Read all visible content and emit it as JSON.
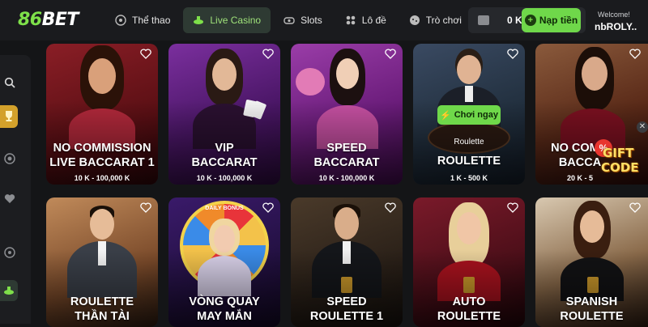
{
  "logo": {
    "prefix": "86",
    "suffix": "BET"
  },
  "nav": [
    {
      "label": "Thể thao",
      "icon": "soccer-ball-icon"
    },
    {
      "label": "Live Casino",
      "icon": "casino-chip-icon",
      "active": true
    },
    {
      "label": "Slots",
      "icon": "slot-icon"
    },
    {
      "label": "Lô đề",
      "icon": "lottery-icon"
    },
    {
      "label": "Trò chơi",
      "icon": "gamepad-icon"
    }
  ],
  "wallet": {
    "balance": "0 K",
    "deposit_label": "Nạp tiền"
  },
  "user": {
    "welcome": "Welcome!",
    "name": "nbROLY.."
  },
  "sidebar": {
    "icons": [
      "search-icon",
      "trophy-icon",
      "casino-chip-icon",
      "heart-icon",
      "soccer-ball-icon",
      "cards-icon"
    ]
  },
  "cards": [
    {
      "title_lines": [
        "NO COMMISSION",
        "LIVE BACCARAT 1"
      ],
      "limits": "10 K - 100,000 K"
    },
    {
      "title_lines": [
        "VIP",
        "BACCARAT"
      ],
      "limits": "10 K - 100,000 K"
    },
    {
      "title_lines": [
        "SPEED",
        "BACCARAT"
      ],
      "limits": "10 K - 100,000 K"
    },
    {
      "title_lines": [
        "ROULETTE"
      ],
      "limits": "1 K - 500 K",
      "sub": "Roulette",
      "play_label": "Chơi ngay"
    },
    {
      "title_lines": [
        "NO COMM",
        "BACCA"
      ],
      "limits": "20 K - 5"
    },
    {
      "title_lines": [
        "ROULETTE",
        "THẦN TÀI"
      ]
    },
    {
      "title_lines": [
        "VÒNG QUAY",
        "MAY MẮN"
      ],
      "wheel_text": "DAILY BONUS"
    },
    {
      "title_lines": [
        "SPEED",
        "ROULETTE 1"
      ]
    },
    {
      "title_lines": [
        "AUTO",
        "ROULETTE"
      ]
    },
    {
      "title_lines": [
        "SPANISH",
        "ROULETTE"
      ]
    }
  ],
  "gift": {
    "line1": "GIFT",
    "line2": "CODE",
    "badge": "%"
  },
  "colors": {
    "accent": "#6fd84a",
    "background": "#141517",
    "topbar": "#1a1b1e"
  }
}
